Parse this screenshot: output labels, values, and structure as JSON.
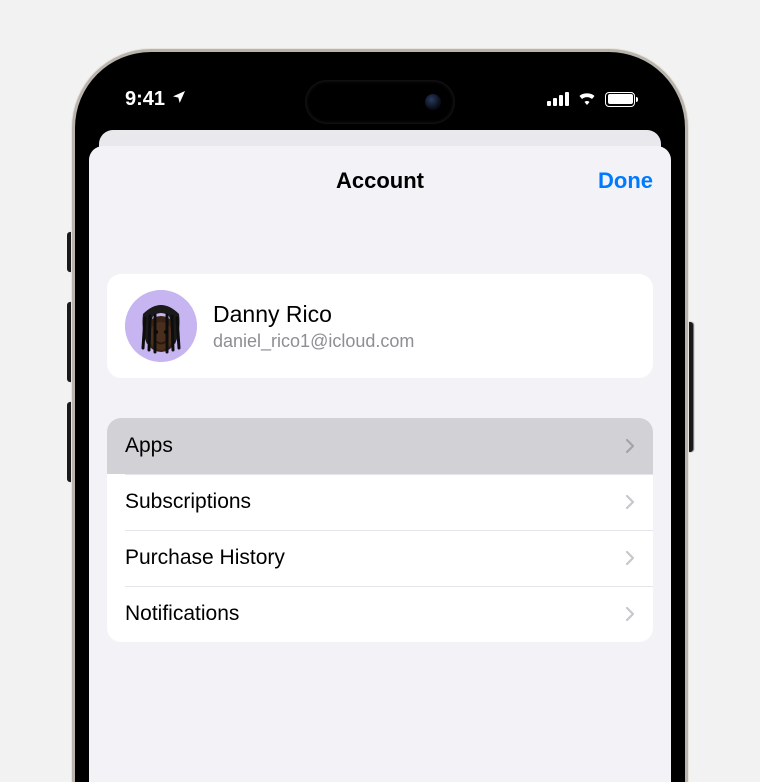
{
  "status": {
    "time": "9:41"
  },
  "modal": {
    "title": "Account",
    "done_label": "Done"
  },
  "profile": {
    "name": "Danny Rico",
    "email": "daniel_rico1@icloud.com"
  },
  "menu": {
    "items": [
      {
        "label": "Apps",
        "highlighted": true
      },
      {
        "label": "Subscriptions",
        "highlighted": false
      },
      {
        "label": "Purchase History",
        "highlighted": false
      },
      {
        "label": "Notifications",
        "highlighted": false
      }
    ]
  },
  "colors": {
    "accent": "#007aff",
    "sheet_bg": "#f2f2f7",
    "avatar_bg": "#c6b5f0"
  }
}
